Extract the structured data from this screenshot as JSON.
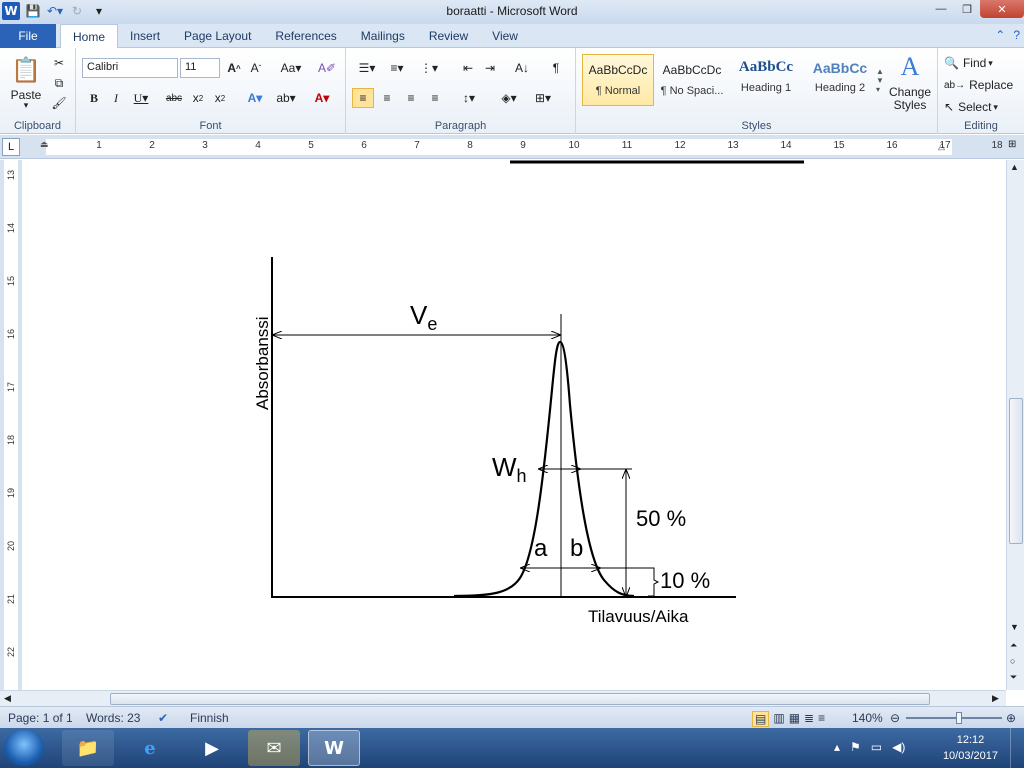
{
  "titlebar": {
    "title": "boraatti - Microsoft Word",
    "qat": [
      "word-logo",
      "save-icon",
      "undo-icon",
      "redo-icon",
      "customize-icon"
    ],
    "minimize": "—",
    "maximize": "❐",
    "close": "✕"
  },
  "ribbon_tabs": {
    "file": "File",
    "tabs": [
      "Home",
      "Insert",
      "Page Layout",
      "References",
      "Mailings",
      "Review",
      "View"
    ],
    "active": "Home"
  },
  "clipboard": {
    "paste": "Paste",
    "label": "Clipboard"
  },
  "font": {
    "name": "Calibri",
    "size": "11",
    "label": "Font"
  },
  "paragraph": {
    "label": "Paragraph"
  },
  "styles": {
    "label": "Styles",
    "items": [
      {
        "sample": "AaBbCcDc",
        "name": "¶ Normal"
      },
      {
        "sample": "AaBbCcDc",
        "name": "¶ No Spaci..."
      },
      {
        "sample": "AaBbCc",
        "name": "Heading 1"
      },
      {
        "sample": "AaBbCc",
        "name": "Heading 2"
      }
    ],
    "change_styles": "Change Styles"
  },
  "editing": {
    "label": "Editing",
    "find": "Find",
    "replace": "Replace",
    "select": "Select"
  },
  "ruler": {
    "numbers": [
      "1",
      "2",
      "3",
      "4",
      "5",
      "6",
      "7",
      "8",
      "9",
      "10",
      "11",
      "12",
      "13",
      "14",
      "15",
      "16",
      "17",
      "18"
    ]
  },
  "vruler": {
    "numbers": [
      "13",
      "14",
      "15",
      "16",
      "17",
      "18",
      "19",
      "20",
      "21",
      "22"
    ]
  },
  "figure": {
    "y_axis_label": "Absorbanssi",
    "x_axis_label": "Tilavuus/Aika",
    "ve_main": "V",
    "ve_sub": "e",
    "wh_main": "W",
    "wh_sub": "h",
    "a": "a",
    "b": "b",
    "pct50": "50 %",
    "pct10": "10 %"
  },
  "status": {
    "page": "Page: 1 of 1",
    "words": "Words: 23",
    "language": "Finnish",
    "zoom": "140%"
  },
  "taskbar": {
    "time": "12:12",
    "date": "10/03/2017"
  },
  "colors": {
    "file_tab": "#2a63b8",
    "taskbar": "#1f4478",
    "accent": "#2a63b8"
  }
}
